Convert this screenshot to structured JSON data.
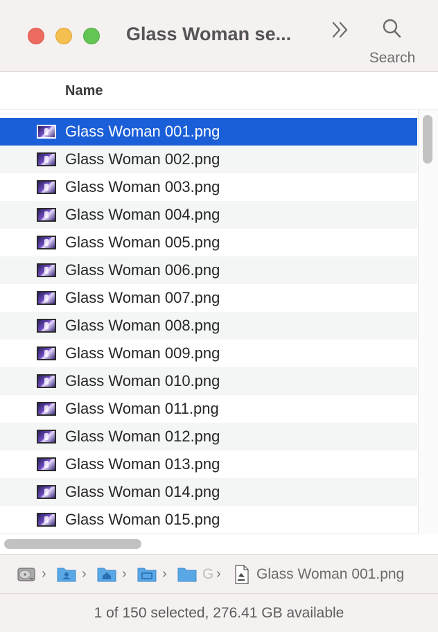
{
  "window": {
    "title": "Glass Woman se..."
  },
  "toolbar": {
    "search_label": "Search"
  },
  "columns": {
    "name": "Name"
  },
  "files": [
    "Glass Woman 001.png",
    "Glass Woman 002.png",
    "Glass Woman 003.png",
    "Glass Woman 004.png",
    "Glass Woman 005.png",
    "Glass Woman 006.png",
    "Glass Woman 007.png",
    "Glass Woman 008.png",
    "Glass Woman 009.png",
    "Glass Woman 010.png",
    "Glass Woman 011.png",
    "Glass Woman 012.png",
    "Glass Woman 013.png",
    "Glass Woman 014.png",
    "Glass Woman 015.png"
  ],
  "selected_index": 0,
  "path_bar": {
    "truncated": "G",
    "file": "Glass Woman 001.png"
  },
  "status": {
    "text": "1 of 150 selected, 276.41 GB available"
  },
  "colors": {
    "selection": "#1a5fd8",
    "close": "#ed6a5e",
    "minimize": "#f5bf4f",
    "zoom": "#62c554",
    "folder": "#5aa7e6"
  }
}
